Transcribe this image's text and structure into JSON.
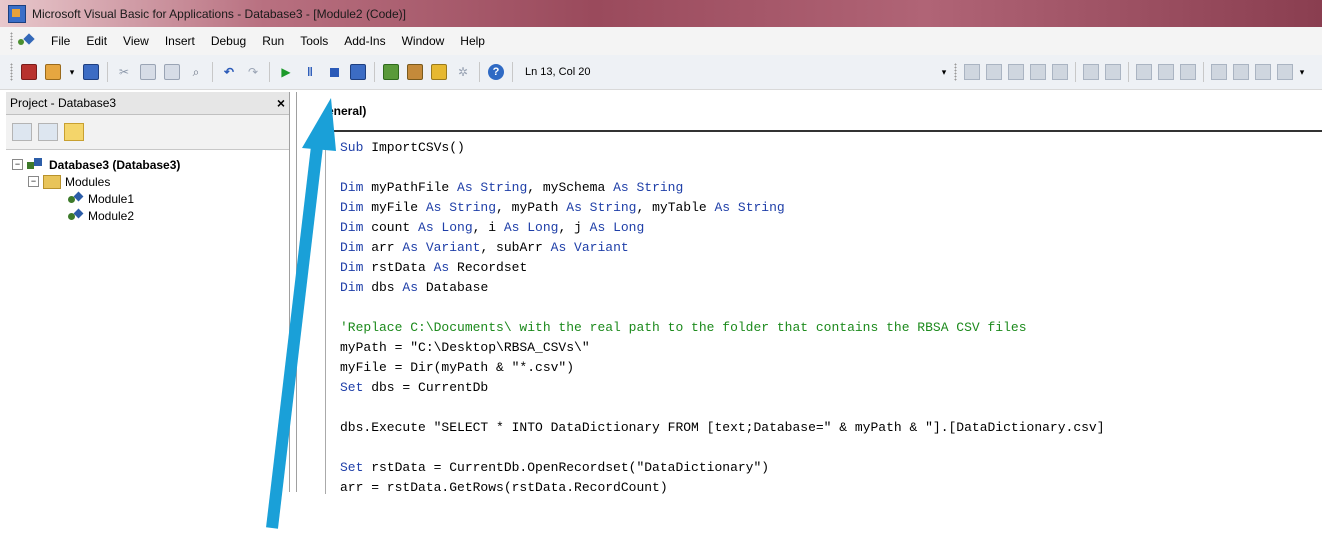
{
  "window": {
    "title": "Microsoft Visual Basic for Applications - Database3 - [Module2 (Code)]"
  },
  "menu": {
    "items": [
      "File",
      "Edit",
      "View",
      "Insert",
      "Debug",
      "Run",
      "Tools",
      "Add-Ins",
      "Window",
      "Help"
    ]
  },
  "toolbar": {
    "cursor_position": "Ln 13, Col 20",
    "icons": [
      "access-icon",
      "insert-module-icon",
      "save-icon",
      "cut-icon",
      "copy-icon",
      "paste-icon",
      "find-icon",
      "undo-icon",
      "redo-icon",
      "run-icon",
      "break-icon",
      "reset-icon",
      "design-mode-icon",
      "project-explorer-icon",
      "properties-icon",
      "object-browser-icon",
      "toolbox-icon",
      "help-icon"
    ]
  },
  "project_pane": {
    "title": "Project - Database3",
    "close_label": "×",
    "tree": {
      "root": "Database3 (Database3)",
      "folder": "Modules",
      "modules": [
        "Module1",
        "Module2"
      ]
    }
  },
  "code_window": {
    "object_dropdown": "eneral)",
    "lines": [
      {
        "kw": "Sub",
        "rest": " ImportCSVs()"
      },
      {
        "kw": "",
        "rest": ""
      },
      {
        "segments": [
          [
            "kw",
            "Dim"
          ],
          [
            "t",
            " myPathFile "
          ],
          [
            "kw",
            "As String"
          ],
          [
            "t",
            ", mySchema "
          ],
          [
            "kw",
            "As String"
          ]
        ]
      },
      {
        "segments": [
          [
            "kw",
            "Dim"
          ],
          [
            "t",
            " myFile "
          ],
          [
            "kw",
            "As String"
          ],
          [
            "t",
            ", myPath "
          ],
          [
            "kw",
            "As String"
          ],
          [
            "t",
            ", myTable "
          ],
          [
            "kw",
            "As String"
          ]
        ]
      },
      {
        "segments": [
          [
            "kw",
            "Dim"
          ],
          [
            "t",
            " count "
          ],
          [
            "kw",
            "As Long"
          ],
          [
            "t",
            ", i "
          ],
          [
            "kw",
            "As Long"
          ],
          [
            "t",
            ", j "
          ],
          [
            "kw",
            "As Long"
          ]
        ]
      },
      {
        "segments": [
          [
            "kw",
            "Dim"
          ],
          [
            "t",
            " arr "
          ],
          [
            "kw",
            "As Variant"
          ],
          [
            "t",
            ", subArr "
          ],
          [
            "kw",
            "As Variant"
          ]
        ]
      },
      {
        "segments": [
          [
            "kw",
            "Dim"
          ],
          [
            "t",
            " rstData "
          ],
          [
            "kw",
            "As"
          ],
          [
            "t",
            " Recordset"
          ]
        ]
      },
      {
        "segments": [
          [
            "kw",
            "Dim"
          ],
          [
            "t",
            " dbs "
          ],
          [
            "kw",
            "As"
          ],
          [
            "t",
            " Database"
          ]
        ]
      },
      {
        "segments": []
      },
      {
        "segments": [
          [
            "cm",
            "'Replace C:\\Documents\\ with the real path to the folder that contains the RBSA CSV files"
          ]
        ]
      },
      {
        "segments": [
          [
            "t",
            "myPath = \"C:\\Desktop\\RBSA_CSVs\\\""
          ]
        ]
      },
      {
        "segments": [
          [
            "t",
            "myFile = Dir(myPath & \"*.csv\")"
          ]
        ]
      },
      {
        "segments": [
          [
            "kw",
            "Set"
          ],
          [
            "t",
            " dbs = CurrentDb"
          ]
        ]
      },
      {
        "segments": []
      },
      {
        "segments": [
          [
            "t",
            "dbs.Execute \"SELECT * INTO DataDictionary FROM [text;Database=\" & myPath & \"].[DataDictionary.csv]"
          ]
        ]
      },
      {
        "segments": []
      },
      {
        "segments": [
          [
            "kw",
            "Set"
          ],
          [
            "t",
            " rstData = CurrentDb.OpenRecordset(\"DataDictionary\")"
          ]
        ]
      },
      {
        "segments": [
          [
            "t",
            "arr = rstData.GetRows(rstData.RecordCount)"
          ]
        ]
      }
    ]
  },
  "colors": {
    "keyword": "#1f3fa8",
    "comment": "#1c8a1c",
    "arrow": "#1aa0d8"
  }
}
